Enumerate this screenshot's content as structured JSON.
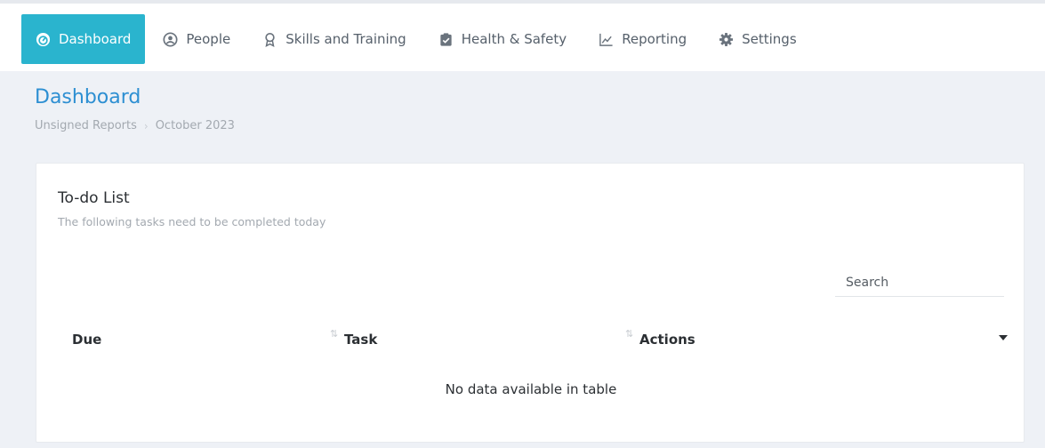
{
  "nav": {
    "items": [
      {
        "label": "Dashboard",
        "icon": "gauge-icon",
        "active": true
      },
      {
        "label": "People",
        "icon": "user-circle-icon",
        "active": false
      },
      {
        "label": "Skills and Training",
        "icon": "award-icon",
        "active": false
      },
      {
        "label": "Health & Safety",
        "icon": "clipboard-check-icon",
        "active": false
      },
      {
        "label": "Reporting",
        "icon": "line-chart-icon",
        "active": false
      },
      {
        "label": "Settings",
        "icon": "gear-icon",
        "active": false
      }
    ]
  },
  "page": {
    "title": "Dashboard",
    "breadcrumb": [
      "Unsigned Reports",
      "October 2023"
    ]
  },
  "todo": {
    "title": "To-do List",
    "subtitle": "The following tasks need to be completed today",
    "search_placeholder": "Search",
    "search_value": "",
    "columns": [
      "Due",
      "Task",
      "Actions"
    ],
    "rows": [],
    "empty_message": "No data available in table"
  },
  "colors": {
    "accent": "#2ab4ce",
    "title": "#2d8fd2",
    "background": "#eef1f6"
  }
}
